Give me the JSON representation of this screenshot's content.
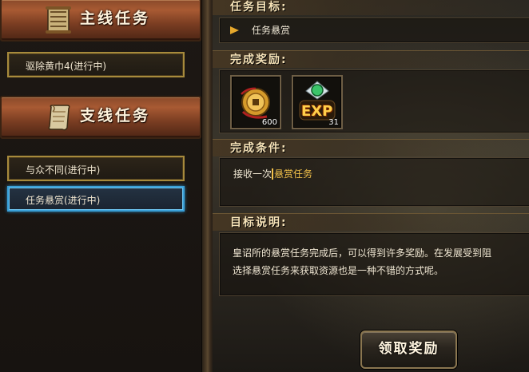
{
  "sidebar": {
    "main_category": {
      "label": "主线任务",
      "icon": "scroll-bundle-icon"
    },
    "main_quests": [
      {
        "label": "驱除黄巾4(进行中)"
      }
    ],
    "side_category": {
      "label": "支线任务",
      "icon": "scroll-icon"
    },
    "side_quests": [
      {
        "label": "与众不同(进行中)",
        "selected": false
      },
      {
        "label": "任务悬赏(进行中)",
        "selected": true
      }
    ]
  },
  "detail": {
    "goal_heading": "任务目标:",
    "goal_text": "任务悬赏",
    "reward_heading": "完成奖励:",
    "rewards": [
      {
        "name": "coins-icon",
        "count": "600"
      },
      {
        "name": "exp-gem-icon",
        "label": "EXP",
        "count": "31"
      }
    ],
    "condition_heading": "完成条件:",
    "condition_prefix": "接收一次",
    "condition_link": "悬赏任务",
    "description_heading": "目标说明:",
    "description_lines": [
      "皇诏所的悬赏任务完成后，可以得到许多奖励。在发展受到阻",
      "选择悬赏任务来获取资源也是一种不错的方式呢。"
    ],
    "claim_button": "领取奖励"
  },
  "colors": {
    "accent_gold": "#e6a82c",
    "selected_blue": "#3aa0d8",
    "link_yellow": "#f1c04a"
  }
}
